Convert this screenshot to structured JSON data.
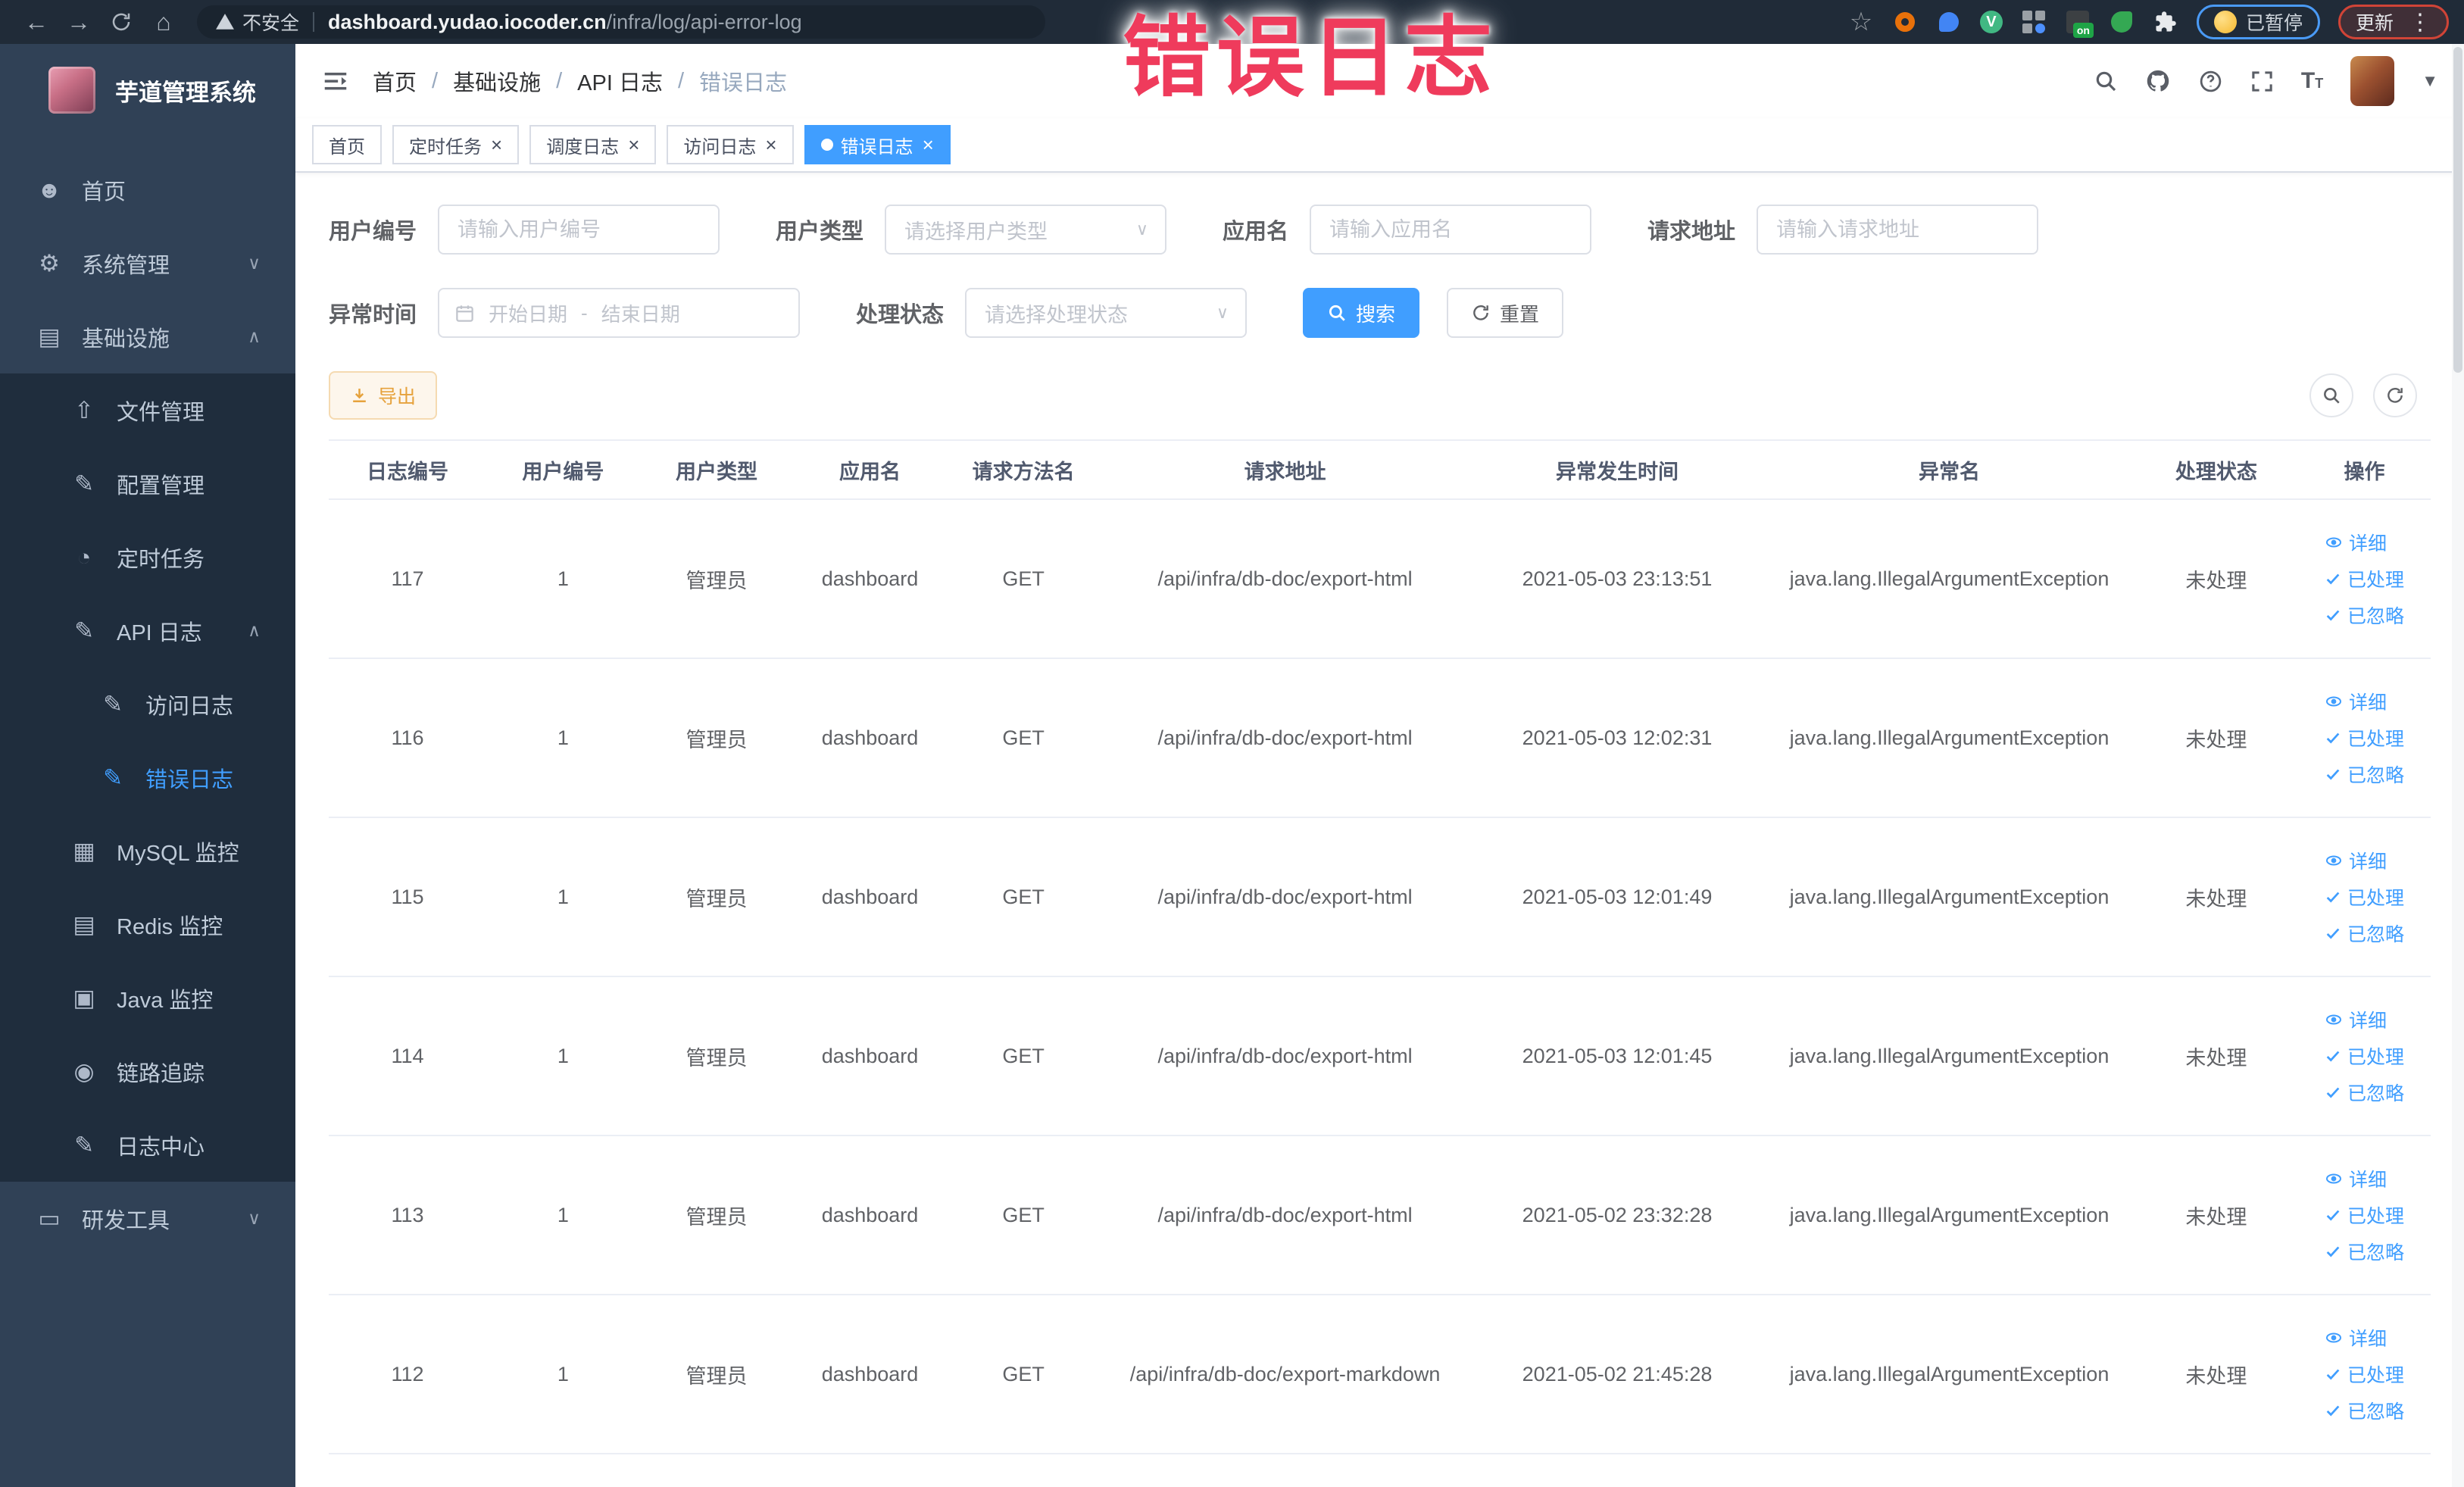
{
  "browser": {
    "security_label": "不安全",
    "url_domain": "dashboard.yudao.iocoder.cn",
    "url_path": "/infra/log/api-error-log",
    "paused_badge": "已暂停",
    "update_button": "更新"
  },
  "annotation": {
    "text": "错误日志",
    "color": "#ef3b5c"
  },
  "sidebar": {
    "app_title": "芋道管理系统",
    "colors": {
      "bg": "#304156",
      "submenu_bg": "#1f2d3d",
      "active": "#409eff"
    },
    "items": [
      {
        "key": "home",
        "label": "首页",
        "icon": "people-icon",
        "level": 1
      },
      {
        "key": "system",
        "label": "系统管理",
        "icon": "gear-icon",
        "level": 1,
        "chevron": "down"
      },
      {
        "key": "infra",
        "label": "基础设施",
        "icon": "monitor-icon",
        "level": 1,
        "chevron": "up"
      },
      {
        "key": "file",
        "label": "文件管理",
        "icon": "upload-icon",
        "level": 2
      },
      {
        "key": "config",
        "label": "配置管理",
        "icon": "edit-icon",
        "level": 2
      },
      {
        "key": "job",
        "label": "定时任务",
        "icon": "timer-icon",
        "level": 2
      },
      {
        "key": "api-log",
        "label": "API 日志",
        "icon": "document-icon",
        "level": 2,
        "chevron": "up"
      },
      {
        "key": "access-log",
        "label": "访问日志",
        "icon": "document-icon",
        "level": 3
      },
      {
        "key": "error-log",
        "label": "错误日志",
        "icon": "document-icon",
        "level": 3,
        "active": true
      },
      {
        "key": "mysql",
        "label": "MySQL 监控",
        "icon": "chart-icon",
        "level": 2
      },
      {
        "key": "redis",
        "label": "Redis 监控",
        "icon": "layers-icon",
        "level": 2
      },
      {
        "key": "java",
        "label": "Java 监控",
        "icon": "screen-icon",
        "level": 2
      },
      {
        "key": "tracer",
        "label": "链路追踪",
        "icon": "eye-icon",
        "level": 2
      },
      {
        "key": "log-center",
        "label": "日志中心",
        "icon": "document-icon",
        "level": 2
      },
      {
        "key": "dev-tools",
        "label": "研发工具",
        "icon": "toolbox-icon",
        "level": 1,
        "chevron": "down"
      }
    ]
  },
  "breadcrumb": {
    "items": [
      "首页",
      "基础设施",
      "API 日志",
      "错误日志"
    ]
  },
  "tabs": [
    {
      "label": "首页",
      "closable": false,
      "active": false
    },
    {
      "label": "定时任务",
      "closable": true,
      "active": false
    },
    {
      "label": "调度日志",
      "closable": true,
      "active": false
    },
    {
      "label": "访问日志",
      "closable": true,
      "active": false
    },
    {
      "label": "错误日志",
      "closable": true,
      "active": true
    }
  ],
  "filters": {
    "user_id": {
      "label": "用户编号",
      "placeholder": "请输入用户编号"
    },
    "user_type": {
      "label": "用户类型",
      "placeholder": "请选择用户类型"
    },
    "app_name": {
      "label": "应用名",
      "placeholder": "请输入应用名"
    },
    "request_url": {
      "label": "请求地址",
      "placeholder": "请输入请求地址"
    },
    "exception_time": {
      "label": "异常时间",
      "start_placeholder": "开始日期",
      "separator": "-",
      "end_placeholder": "结束日期"
    },
    "process_status": {
      "label": "处理状态",
      "placeholder": "请选择处理状态"
    },
    "search_button": "搜索",
    "reset_button": "重置"
  },
  "toolbar": {
    "export_button": "导出"
  },
  "table": {
    "headers": [
      "日志编号",
      "用户编号",
      "用户类型",
      "应用名",
      "请求方法名",
      "请求地址",
      "异常发生时间",
      "异常名",
      "处理状态",
      "操作"
    ],
    "actions": [
      "详细",
      "已处理",
      "已忽略"
    ],
    "rows": [
      {
        "id": "117",
        "user_id": "1",
        "user_type": "管理员",
        "app": "dashboard",
        "method": "GET",
        "url": "/api/infra/db-doc/export-html",
        "time": "2021-05-03 23:13:51",
        "exception": "java.lang.IllegalArgumentException",
        "status": "未处理"
      },
      {
        "id": "116",
        "user_id": "1",
        "user_type": "管理员",
        "app": "dashboard",
        "method": "GET",
        "url": "/api/infra/db-doc/export-html",
        "time": "2021-05-03 12:02:31",
        "exception": "java.lang.IllegalArgumentException",
        "status": "未处理"
      },
      {
        "id": "115",
        "user_id": "1",
        "user_type": "管理员",
        "app": "dashboard",
        "method": "GET",
        "url": "/api/infra/db-doc/export-html",
        "time": "2021-05-03 12:01:49",
        "exception": "java.lang.IllegalArgumentException",
        "status": "未处理"
      },
      {
        "id": "114",
        "user_id": "1",
        "user_type": "管理员",
        "app": "dashboard",
        "method": "GET",
        "url": "/api/infra/db-doc/export-html",
        "time": "2021-05-03 12:01:45",
        "exception": "java.lang.IllegalArgumentException",
        "status": "未处理"
      },
      {
        "id": "113",
        "user_id": "1",
        "user_type": "管理员",
        "app": "dashboard",
        "method": "GET",
        "url": "/api/infra/db-doc/export-html",
        "time": "2021-05-02 23:32:28",
        "exception": "java.lang.IllegalArgumentException",
        "status": "未处理"
      },
      {
        "id": "112",
        "user_id": "1",
        "user_type": "管理员",
        "app": "dashboard",
        "method": "GET",
        "url": "/api/infra/db-doc/export-markdown",
        "time": "2021-05-02 21:45:28",
        "exception": "java.lang.IllegalArgumentException",
        "status": "未处理"
      }
    ]
  },
  "accent_color": "#409eff",
  "warning_color": "#e6a23c"
}
